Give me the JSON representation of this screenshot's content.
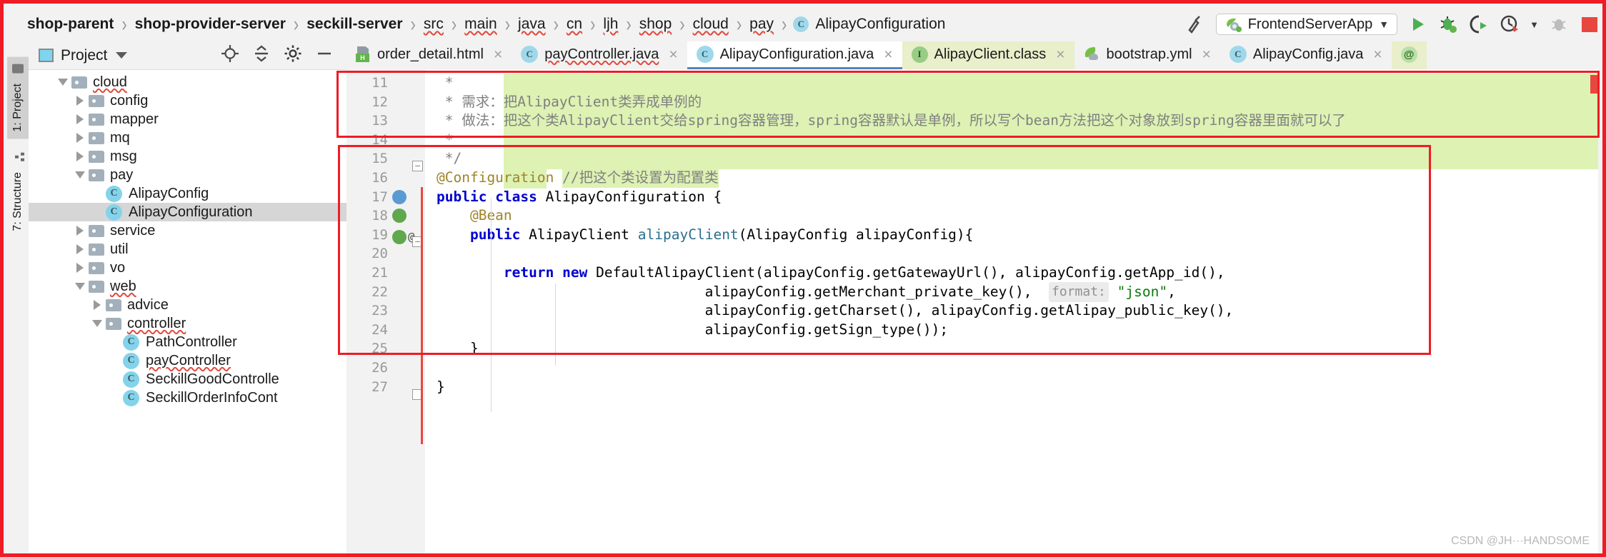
{
  "breadcrumb": {
    "items": [
      {
        "label": "shop-parent",
        "bold": true,
        "squiggle": false,
        "icon": null
      },
      {
        "label": "shop-provider-server",
        "bold": true,
        "squiggle": false,
        "icon": null
      },
      {
        "label": "seckill-server",
        "bold": true,
        "squiggle": false,
        "icon": null
      },
      {
        "label": "src",
        "bold": false,
        "squiggle": true,
        "icon": null
      },
      {
        "label": "main",
        "bold": false,
        "squiggle": true,
        "icon": null
      },
      {
        "label": "java",
        "bold": false,
        "squiggle": true,
        "icon": null
      },
      {
        "label": "cn",
        "bold": false,
        "squiggle": true,
        "icon": null
      },
      {
        "label": "ljh",
        "bold": false,
        "squiggle": true,
        "icon": null
      },
      {
        "label": "shop",
        "bold": false,
        "squiggle": true,
        "icon": null
      },
      {
        "label": "cloud",
        "bold": false,
        "squiggle": true,
        "icon": null
      },
      {
        "label": "pay",
        "bold": false,
        "squiggle": true,
        "icon": null
      },
      {
        "label": "AlipayConfiguration",
        "bold": false,
        "squiggle": false,
        "icon": "class-icon"
      }
    ],
    "separator": "›"
  },
  "toolbar": {
    "hammer_icon": "build-hammer-icon",
    "run_config": {
      "label": "FrontendServerApp",
      "icon": "spring-boot-app-icon",
      "dropdown": "▼"
    },
    "run_label": "run-button",
    "debug_label": "debug-button",
    "run_with_coverage_label": "run-with-coverage-button",
    "profiler_label": "profiler-button",
    "attach_label": "attach-debugger-button",
    "stop_label": "stop-button"
  },
  "toolstrip": {
    "project_tab": "1: Project",
    "structure_tab": "7: Structure"
  },
  "project_panel": {
    "title": "Project",
    "locate_icon": "locate-file-icon",
    "collapse_icon": "collapse-all-icon",
    "settings_icon": "gear-icon",
    "hide_icon": "hide-panel-icon",
    "tree": [
      {
        "label": "cloud",
        "depth": 3,
        "type": "folder",
        "state": "expanded",
        "selected": false,
        "squiggle": true
      },
      {
        "label": "config",
        "depth": 4,
        "type": "folder",
        "state": "collapsed",
        "selected": false,
        "squiggle": false
      },
      {
        "label": "mapper",
        "depth": 4,
        "type": "folder",
        "state": "collapsed",
        "selected": false,
        "squiggle": false
      },
      {
        "label": "mq",
        "depth": 4,
        "type": "folder",
        "state": "collapsed",
        "selected": false,
        "squiggle": false
      },
      {
        "label": "msg",
        "depth": 4,
        "type": "folder",
        "state": "collapsed",
        "selected": false,
        "squiggle": false
      },
      {
        "label": "pay",
        "depth": 4,
        "type": "folder",
        "state": "expanded",
        "selected": false,
        "squiggle": false
      },
      {
        "label": "AlipayConfig",
        "depth": 5,
        "type": "class",
        "state": "leaf",
        "selected": false,
        "squiggle": false
      },
      {
        "label": "AlipayConfiguration",
        "depth": 5,
        "type": "class",
        "state": "leaf",
        "selected": true,
        "squiggle": false
      },
      {
        "label": "service",
        "depth": 4,
        "type": "folder",
        "state": "collapsed",
        "selected": false,
        "squiggle": false
      },
      {
        "label": "util",
        "depth": 4,
        "type": "folder",
        "state": "collapsed",
        "selected": false,
        "squiggle": false
      },
      {
        "label": "vo",
        "depth": 4,
        "type": "folder",
        "state": "collapsed",
        "selected": false,
        "squiggle": false
      },
      {
        "label": "web",
        "depth": 4,
        "type": "folder",
        "state": "expanded",
        "selected": false,
        "squiggle": true
      },
      {
        "label": "advice",
        "depth": 5,
        "type": "folder",
        "state": "collapsed",
        "selected": false,
        "squiggle": false
      },
      {
        "label": "controller",
        "depth": 5,
        "type": "folder",
        "state": "expanded",
        "selected": false,
        "squiggle": true
      },
      {
        "label": "PathController",
        "depth": 6,
        "type": "class",
        "state": "leaf",
        "selected": false,
        "squiggle": false
      },
      {
        "label": "payController",
        "depth": 6,
        "type": "class",
        "state": "leaf",
        "selected": false,
        "squiggle": true
      },
      {
        "label": "SeckillGoodControlle",
        "depth": 6,
        "type": "class",
        "state": "leaf",
        "selected": false,
        "squiggle": false
      },
      {
        "label": "SeckillOrderInfoCont",
        "depth": 6,
        "type": "class",
        "state": "leaf",
        "selected": false,
        "squiggle": false
      }
    ]
  },
  "tabs": [
    {
      "label": "order_detail.html",
      "icon": "html-file-icon",
      "active": false,
      "highlight": false,
      "squiggle": false,
      "close": "×"
    },
    {
      "label": "payController.java",
      "icon": "java-class-icon",
      "active": false,
      "highlight": false,
      "squiggle": true,
      "close": "×"
    },
    {
      "label": "AlipayConfiguration.java",
      "icon": "java-class-icon",
      "active": true,
      "highlight": false,
      "squiggle": false,
      "close": "×"
    },
    {
      "label": "AlipayClient.class",
      "icon": "java-interface-icon",
      "active": false,
      "highlight": true,
      "squiggle": false,
      "close": "×"
    },
    {
      "label": "bootstrap.yml",
      "icon": "spring-yaml-icon",
      "active": false,
      "highlight": false,
      "squiggle": false,
      "close": "×"
    },
    {
      "label": "AlipayConfig.java",
      "icon": "java-class-icon",
      "active": false,
      "highlight": false,
      "squiggle": false,
      "close": "×"
    },
    {
      "label": "",
      "icon": "annotation-icon",
      "active": false,
      "highlight": true,
      "squiggle": false,
      "close": ""
    }
  ],
  "editor": {
    "lines": [
      {
        "n": "11",
        "text": " *",
        "marks": [],
        "kind": "comment"
      },
      {
        "n": "12",
        "text": " * 需求：把AlipayClient类弄成单例的",
        "marks": [],
        "kind": "comment"
      },
      {
        "n": "13",
        "text": " * 做法：把这个类AlipayClient交给spring容器管理，spring容器默认是单例，所以写个bean方法把这个对象放到spring容器里面就可以了",
        "marks": [],
        "kind": "comment"
      },
      {
        "n": "14",
        "text": " *",
        "marks": [],
        "kind": "comment"
      },
      {
        "n": "15",
        "text": " */",
        "marks": [],
        "kind": "comment-end"
      },
      {
        "n": "16",
        "text": "@Configuration //把这个类设置为配置类",
        "marks": [],
        "kind": "annotation-line"
      },
      {
        "n": "17",
        "text": "public class AlipayConfiguration {",
        "marks": [
          "bean-blue"
        ],
        "kind": "code"
      },
      {
        "n": "18",
        "text": "    @Bean",
        "marks": [
          "bean-green"
        ],
        "kind": "code"
      },
      {
        "n": "19",
        "text": "    public AlipayClient alipayClient(AlipayConfig alipayConfig){",
        "marks": [
          "bean-green",
          "at"
        ],
        "kind": "code"
      },
      {
        "n": "20",
        "text": "",
        "marks": [],
        "kind": "code"
      },
      {
        "n": "21",
        "text": "        return new DefaultAlipayClient(alipayConfig.getGatewayUrl(), alipayConfig.getApp_id(),",
        "marks": [],
        "kind": "code"
      },
      {
        "n": "22",
        "text": "                                alipayConfig.getMerchant_private_key(),  format: \"json\",",
        "marks": [],
        "kind": "code"
      },
      {
        "n": "23",
        "text": "                                alipayConfig.getCharset(), alipayConfig.getAlipay_public_key(),",
        "marks": [],
        "kind": "code"
      },
      {
        "n": "24",
        "text": "                                alipayConfig.getSign_type());",
        "marks": [],
        "kind": "code"
      },
      {
        "n": "25",
        "text": "    }",
        "marks": [],
        "kind": "code"
      },
      {
        "n": "26",
        "text": "",
        "marks": [],
        "kind": "code"
      },
      {
        "n": "27",
        "text": "}",
        "marks": [],
        "kind": "code"
      }
    ],
    "inlay_hint": "format:",
    "string_literal": "\"json\""
  },
  "watermark": "CSDN @JH···HANDSOME",
  "colors": {
    "annotation_red": "#ee1c25",
    "comment_highlight": "#ddf2b3",
    "keyword_blue": "#0000d0",
    "annotation_gold": "#9e8428",
    "string_green": "#0c7a0c",
    "method_teal": "#2a6f8e",
    "tab_active_underline": "#4a86c8",
    "selection_gray": "#d6d6d6"
  }
}
